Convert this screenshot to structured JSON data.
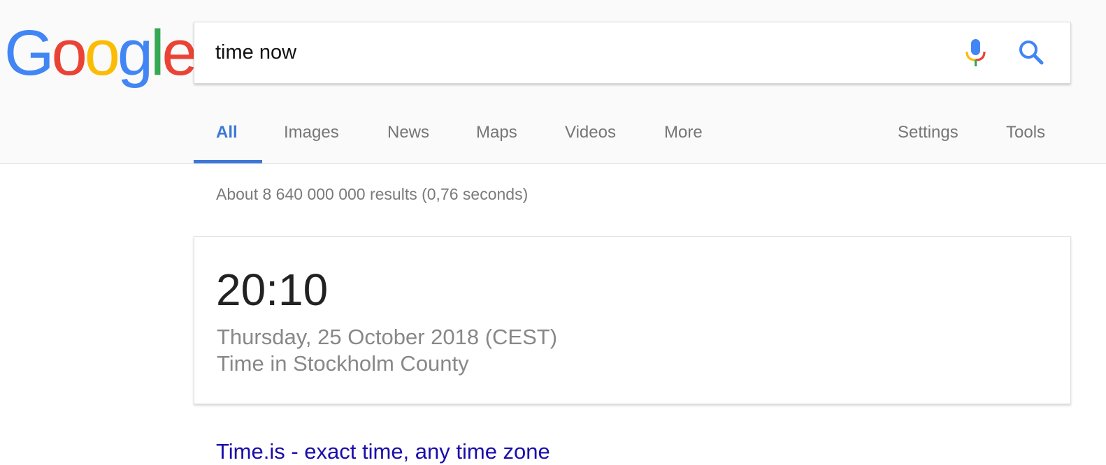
{
  "logo": {
    "letters": [
      "G",
      "o",
      "o",
      "g",
      "l",
      "e"
    ],
    "colors": [
      "#4285f4",
      "#ea4335",
      "#fbbc05",
      "#4285f4",
      "#34a853",
      "#ea4335"
    ]
  },
  "search": {
    "value": "time now",
    "mic_icon": "microphone-icon",
    "search_icon": "magnifier-icon",
    "accent": "#4285f4"
  },
  "tabs": {
    "left": [
      "All",
      "Images",
      "News",
      "Maps",
      "Videos",
      "More"
    ],
    "right": [
      "Settings",
      "Tools"
    ],
    "active": "All",
    "active_color": "#3d78d8"
  },
  "results": {
    "stats": "About 8 640 000 000 results (0,76 seconds)",
    "time_card": {
      "time": "20:10",
      "date": "Thursday, 25 October 2018 (CEST)",
      "location": "Time in Stockholm County"
    },
    "first_result_title": "Time.is - exact time, any time zone",
    "link_color": "#1a0dab"
  }
}
